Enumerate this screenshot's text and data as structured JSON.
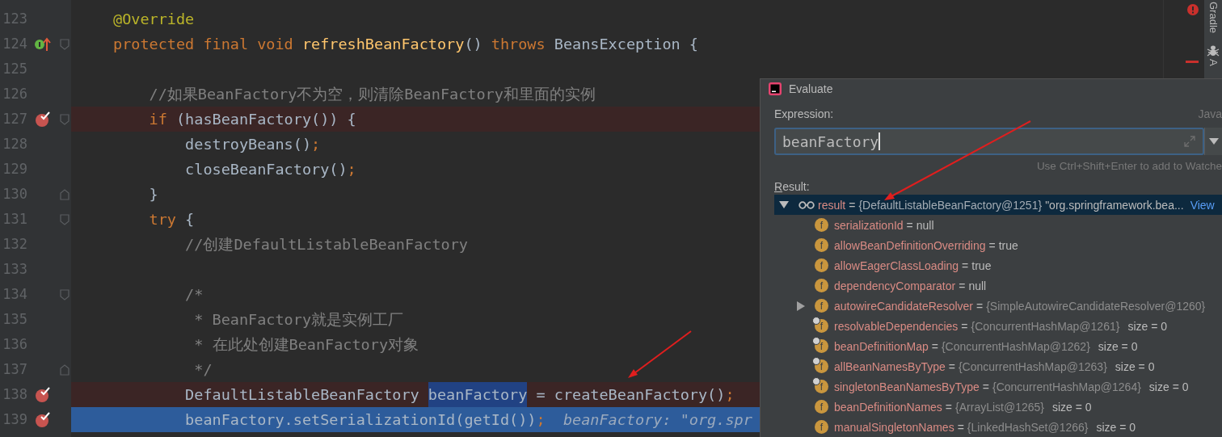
{
  "editor": {
    "lines": [
      {
        "number": "123",
        "breakpoint": false,
        "implements": false,
        "fold_start": false,
        "fold_end": false,
        "execution_point": false,
        "tokens": [
          {
            "text": "@Override",
            "kind": "annotation"
          }
        ]
      },
      {
        "number": "124",
        "breakpoint": false,
        "implements": true,
        "fold_start": true,
        "fold_end": false,
        "execution_point": false,
        "tokens": [
          {
            "text": "protected final void ",
            "kind": "keyword"
          },
          {
            "text": "refreshBeanFactory",
            "kind": "method"
          },
          {
            "text": "() ",
            "kind": "plain"
          },
          {
            "text": "throws ",
            "kind": "keyword"
          },
          {
            "text": "BeansException {",
            "kind": "plain"
          }
        ]
      },
      {
        "number": "125",
        "breakpoint": false,
        "implements": false,
        "fold_start": false,
        "fold_end": false,
        "execution_point": false
      },
      {
        "number": "126",
        "breakpoint": false,
        "implements": false,
        "fold_start": false,
        "fold_end": false,
        "execution_point": false,
        "tokens": [
          {
            "text": "    //如果BeanFactory不为空，则清除BeanFactory和里面的实例",
            "kind": "comment"
          }
        ]
      },
      {
        "number": "127",
        "breakpoint": true,
        "implements": false,
        "fold_start": true,
        "fold_end": false,
        "execution_point": false,
        "tokens": [
          {
            "text": "    if",
            "kind": "keyword"
          },
          {
            "text": " (hasBeanFactory()) {",
            "kind": "plain"
          }
        ]
      },
      {
        "number": "128",
        "breakpoint": false,
        "implements": false,
        "fold_start": false,
        "fold_end": false,
        "execution_point": false,
        "tokens": [
          {
            "text": "        destroyBeans()",
            "kind": "plain"
          },
          {
            "text": ";",
            "kind": "punct"
          }
        ]
      },
      {
        "number": "129",
        "breakpoint": false,
        "implements": false,
        "fold_start": false,
        "fold_end": false,
        "execution_point": false,
        "tokens": [
          {
            "text": "        closeBeanFactory()",
            "kind": "plain"
          },
          {
            "text": ";",
            "kind": "punct"
          }
        ]
      },
      {
        "number": "130",
        "breakpoint": false,
        "implements": false,
        "fold_start": false,
        "fold_end": true,
        "execution_point": false,
        "tokens": [
          {
            "text": "    }",
            "kind": "plain"
          }
        ]
      },
      {
        "number": "131",
        "breakpoint": false,
        "implements": false,
        "fold_start": true,
        "fold_end": false,
        "execution_point": false,
        "tokens": [
          {
            "text": "    try",
            "kind": "keyword"
          },
          {
            "text": " {",
            "kind": "plain"
          }
        ]
      },
      {
        "number": "132",
        "breakpoint": false,
        "implements": false,
        "fold_start": false,
        "fold_end": false,
        "execution_point": false,
        "tokens": [
          {
            "text": "        //创建DefaultListableBeanFactory",
            "kind": "comment"
          }
        ]
      },
      {
        "number": "133",
        "breakpoint": false,
        "implements": false,
        "fold_start": false,
        "fold_end": false,
        "execution_point": false
      },
      {
        "number": "134",
        "breakpoint": false,
        "implements": false,
        "fold_start": true,
        "fold_end": false,
        "execution_point": false,
        "tokens": [
          {
            "text": "        /*",
            "kind": "comment"
          }
        ]
      },
      {
        "number": "135",
        "breakpoint": false,
        "implements": false,
        "fold_start": false,
        "fold_end": false,
        "execution_point": false,
        "tokens": [
          {
            "text": "         * BeanFactory就是实例工厂",
            "kind": "comment"
          }
        ]
      },
      {
        "number": "136",
        "breakpoint": false,
        "implements": false,
        "fold_start": false,
        "fold_end": false,
        "execution_point": false,
        "tokens": [
          {
            "text": "         * 在此处创建BeanFactory对象",
            "kind": "comment"
          }
        ]
      },
      {
        "number": "137",
        "breakpoint": false,
        "implements": false,
        "fold_start": false,
        "fold_end": true,
        "execution_point": false,
        "tokens": [
          {
            "text": "         */",
            "kind": "comment"
          }
        ]
      },
      {
        "number": "138",
        "breakpoint": true,
        "implements": false,
        "fold_start": false,
        "fold_end": false,
        "execution_point": false,
        "tokens": [
          {
            "text": "        DefaultListableBeanFactory ",
            "kind": "plain"
          },
          {
            "text": "beanFactory",
            "kind": "match"
          },
          {
            "text": " = createBeanFactory()",
            "kind": "plain"
          },
          {
            "text": ";",
            "kind": "punct"
          }
        ]
      },
      {
        "number": "139",
        "breakpoint": true,
        "implements": false,
        "fold_start": false,
        "fold_end": false,
        "execution_point": true,
        "tokens": [
          {
            "text": "        beanFactory.setSerializationId(getId())",
            "kind": "plain"
          },
          {
            "text": ";",
            "kind": "punct"
          },
          {
            "text": "  beanFactory: \"org.spr",
            "kind": "hint"
          }
        ]
      }
    ]
  },
  "tool_strip": [
    {
      "label": "Gradle",
      "kind": "text"
    },
    {
      "label": "A",
      "kind": "icon-text"
    }
  ],
  "evaluate_dialog": {
    "title": "Evaluate",
    "expression_label": "Expression:",
    "language": "Java",
    "expression": "beanFactory",
    "hint": "Use Ctrl+Shift+Enter to add to Watche",
    "result_label": "Result:",
    "result": {
      "name": "result",
      "equals": "=",
      "value": "{DefaultListableBeanFactory@1251}",
      "text": "\"org.springframework.bea...",
      "link": "View",
      "expanded": true,
      "selected": true
    },
    "children": [
      {
        "badge": "f",
        "name": "serializationId",
        "equals": "=",
        "value": "null",
        "kind": "literal",
        "expandable": false,
        "final": false
      },
      {
        "badge": "f",
        "name": "allowBeanDefinitionOverriding",
        "equals": "=",
        "value": "true",
        "kind": "literal",
        "expandable": false,
        "final": false
      },
      {
        "badge": "f",
        "name": "allowEagerClassLoading",
        "equals": "=",
        "value": "true",
        "kind": "literal",
        "expandable": false,
        "final": false
      },
      {
        "badge": "f",
        "name": "dependencyComparator",
        "equals": "=",
        "value": "null",
        "kind": "literal",
        "expandable": false,
        "final": false
      },
      {
        "badge": "f",
        "name": "autowireCandidateResolver",
        "equals": "=",
        "value": "{SimpleAutowireCandidateResolver@1260}",
        "kind": "object",
        "expandable": true,
        "final": false
      },
      {
        "badge": "f",
        "name": "resolvableDependencies",
        "equals": "=",
        "value": "{ConcurrentHashMap@1261}",
        "size": "size = 0",
        "kind": "object",
        "expandable": false,
        "final": true
      },
      {
        "badge": "f",
        "name": "beanDefinitionMap",
        "equals": "=",
        "value": "{ConcurrentHashMap@1262}",
        "size": "size = 0",
        "kind": "object",
        "expandable": false,
        "final": true
      },
      {
        "badge": "f",
        "name": "allBeanNamesByType",
        "equals": "=",
        "value": "{ConcurrentHashMap@1263}",
        "size": "size = 0",
        "kind": "object",
        "expandable": false,
        "final": true
      },
      {
        "badge": "f",
        "name": "singletonBeanNamesByType",
        "equals": "=",
        "value": "{ConcurrentHashMap@1264}",
        "size": "size = 0",
        "kind": "object",
        "expandable": false,
        "final": true
      },
      {
        "badge": "f",
        "name": "beanDefinitionNames",
        "equals": "=",
        "value": "{ArrayList@1265}",
        "size": "size = 0",
        "kind": "object",
        "expandable": false,
        "final": false
      },
      {
        "badge": "f",
        "name": "manualSingletonNames",
        "equals": "=",
        "value": "{LinkedHashSet@1266}",
        "size": "size = 0",
        "kind": "object",
        "expandable": false,
        "final": false
      }
    ]
  }
}
